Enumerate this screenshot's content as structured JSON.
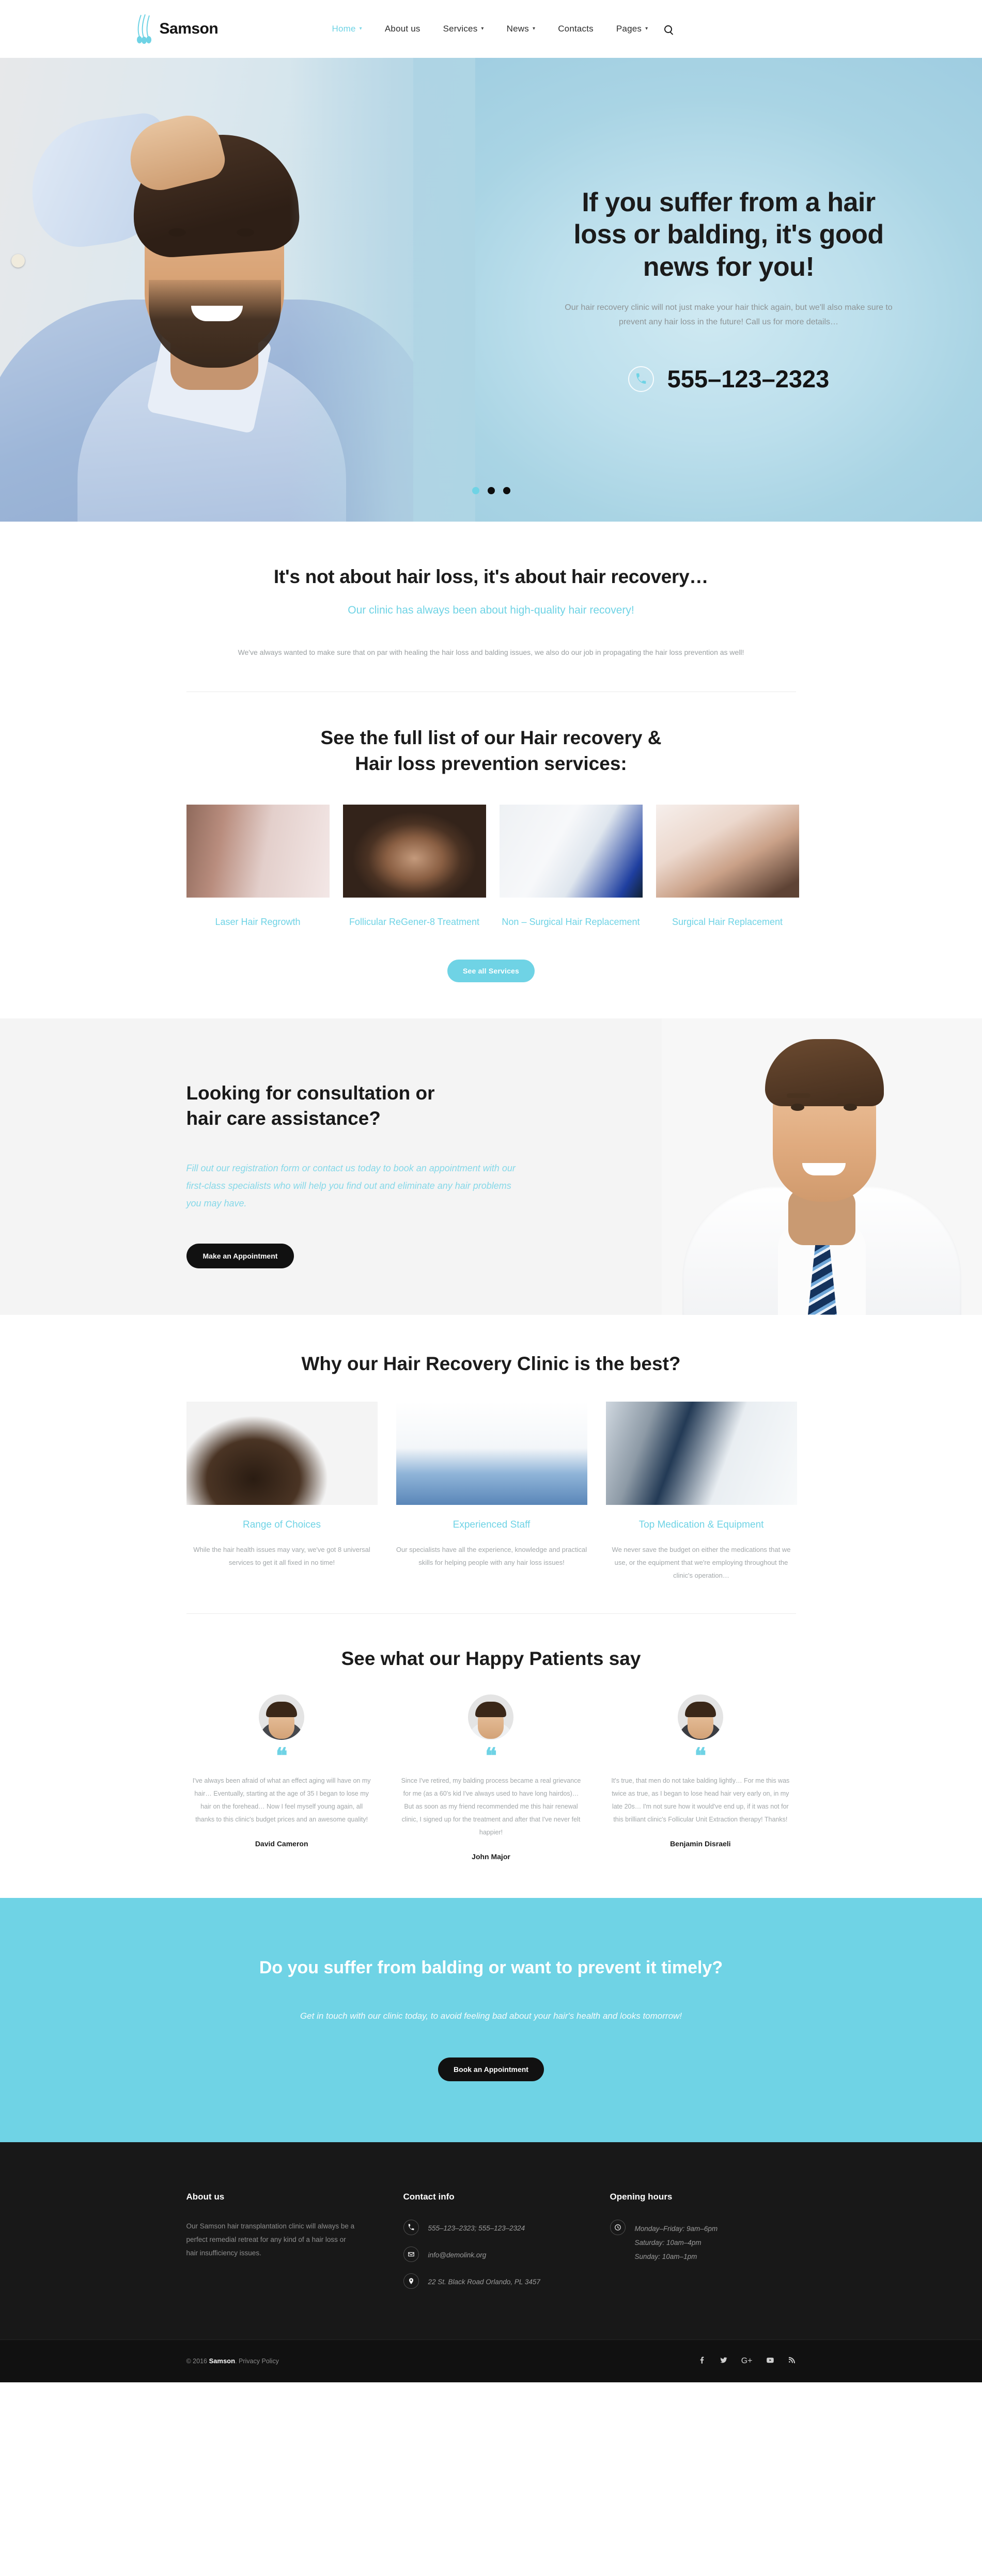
{
  "brand": {
    "name": "Samson",
    "logo_icon": "hair-follicle-logo"
  },
  "nav": {
    "items": [
      {
        "label": "Home",
        "has_dropdown": true,
        "active": true
      },
      {
        "label": "About us",
        "has_dropdown": false,
        "active": false
      },
      {
        "label": "Services",
        "has_dropdown": true,
        "active": false
      },
      {
        "label": "News",
        "has_dropdown": true,
        "active": false
      },
      {
        "label": "Contacts",
        "has_dropdown": false,
        "active": false
      },
      {
        "label": "Pages",
        "has_dropdown": true,
        "active": false
      }
    ],
    "search_icon": "search-icon"
  },
  "hero": {
    "title": "If you suffer from a hair loss or balding, it's good news for you!",
    "subtitle": "Our hair recovery clinic will not just make your hair thick again, but we'll also make sure to prevent any hair loss in the future! Call us for more details…",
    "phone": "555–123–2323",
    "phone_icon": "phone-icon",
    "slides": 3,
    "active_slide": 1
  },
  "intro": {
    "heading": "It's not about hair loss, it's about hair recovery…",
    "accent": "Our clinic has always been about high-quality hair recovery!",
    "body": "We've always wanted to make sure that on par with healing the hair loss and balding issues, we also do our job in propagating the hair loss prevention as well!"
  },
  "services": {
    "heading_line1": "See the full list of our Hair recovery &",
    "heading_line2": "Hair loss prevention services:",
    "items": [
      {
        "label": "Laser Hair Regrowth",
        "image": "scalp-marking-photo"
      },
      {
        "label": "Follicular ReGener-8 Treatment",
        "image": "balding-crown-photo"
      },
      {
        "label": "Non – Surgical Hair Replacement",
        "image": "clinic-device-photo"
      },
      {
        "label": "Surgical Hair Replacement",
        "image": "scalp-treatment-photo"
      }
    ],
    "button": "See all Services"
  },
  "consultation": {
    "heading": "Looking for consultation or hair care assistance?",
    "body": "Fill out our registration form or contact us today to book an appointment with our first-class specialists who will help you find out and eliminate any hair problems you may have.",
    "button": "Make an Appointment",
    "image": "smiling-doctor-photo"
  },
  "why": {
    "heading": "Why our Hair Recovery Clinic is the best?",
    "items": [
      {
        "title": "Range of Choices",
        "image": "thick-hair-photo",
        "text": "While the hair health issues may vary, we've got 8 universal services to get it all fixed in no time!"
      },
      {
        "title": "Experienced Staff",
        "image": "medical-team-photo",
        "text": "Our specialists have all the experience, knowledge and practical skills for helping people with any hair loss issues!"
      },
      {
        "title": "Top Medication & Equipment",
        "image": "ultrasound-device-photo",
        "text": "We never save the budget on either the medications that we use, or the equipment that we're employing throughout the clinic's operation…"
      }
    ]
  },
  "testimonials": {
    "heading": "See what our Happy Patients say",
    "quote_icon": "quote-mark-icon",
    "items": [
      {
        "avatar": "patient-avatar-1",
        "text": "I've always been afraid of what an effect aging will have on my hair… Eventually, starting at the age of 35 I began to lose my hair on the forehead… Now I feel myself young again, all thanks to this clinic's budget prices and an awesome quality!",
        "name": "David Cameron"
      },
      {
        "avatar": "patient-avatar-2",
        "text": "Since I've retired, my balding process became a real grievance for me (as a 60's kid I've always used to have long hairdos)… But as soon as my friend recommended me this hair renewal clinic, I signed up for the treatment and after that I've never felt happier!",
        "name": "John Major"
      },
      {
        "avatar": "patient-avatar-3",
        "text": "It's true, that men do not take balding lightly… For me this was twice as true, as I began to lose head hair very early on, in my late 20s… I'm not sure how it would've end up, if it was not for this brilliant clinic's Follicular Unit Extraction therapy! Thanks!",
        "name": "Benjamin Disraeli"
      }
    ]
  },
  "cta": {
    "heading": "Do you suffer from balding or want to prevent it timely?",
    "body": "Get in touch with our clinic today, to avoid feeling bad about your hair's health and looks tomorrow!",
    "button": "Book an Appointment"
  },
  "footer": {
    "about": {
      "title": "About us",
      "text": "Our Samson hair transplantation clinic will always be a perfect remedial retreat for any kind of a hair loss or hair insufficiency issues."
    },
    "contact": {
      "title": "Contact info",
      "phone": "555–123–2323; 555–123–2324",
      "phone_icon": "phone-icon",
      "email": "info@demolink.org",
      "email_icon": "envelope-icon",
      "address": "22 St. Black Road Orlando, PL 3457",
      "address_icon": "map-pin-icon"
    },
    "hours": {
      "title": "Opening hours",
      "clock_icon": "clock-icon",
      "lines": [
        "Monday–Friday: 9am–6pm",
        "Saturday: 10am–4pm",
        "Sunday: 10am–1pm"
      ]
    },
    "copyright_prefix": "© 2016",
    "copyright_brand": "Samson",
    "copyright_suffix": ".",
    "privacy_label": "Privacy Policy",
    "socials": [
      {
        "name": "facebook-icon",
        "glyph": "f"
      },
      {
        "name": "twitter-icon",
        "glyph": "t"
      },
      {
        "name": "google-plus-icon",
        "glyph": "G+"
      },
      {
        "name": "youtube-icon",
        "glyph": "yt"
      },
      {
        "name": "rss-icon",
        "glyph": "rss"
      }
    ]
  },
  "colors": {
    "accent": "#6fd3e5",
    "dark": "#181818",
    "text": "#1b1b1b",
    "muted": "#9a9fa1"
  }
}
